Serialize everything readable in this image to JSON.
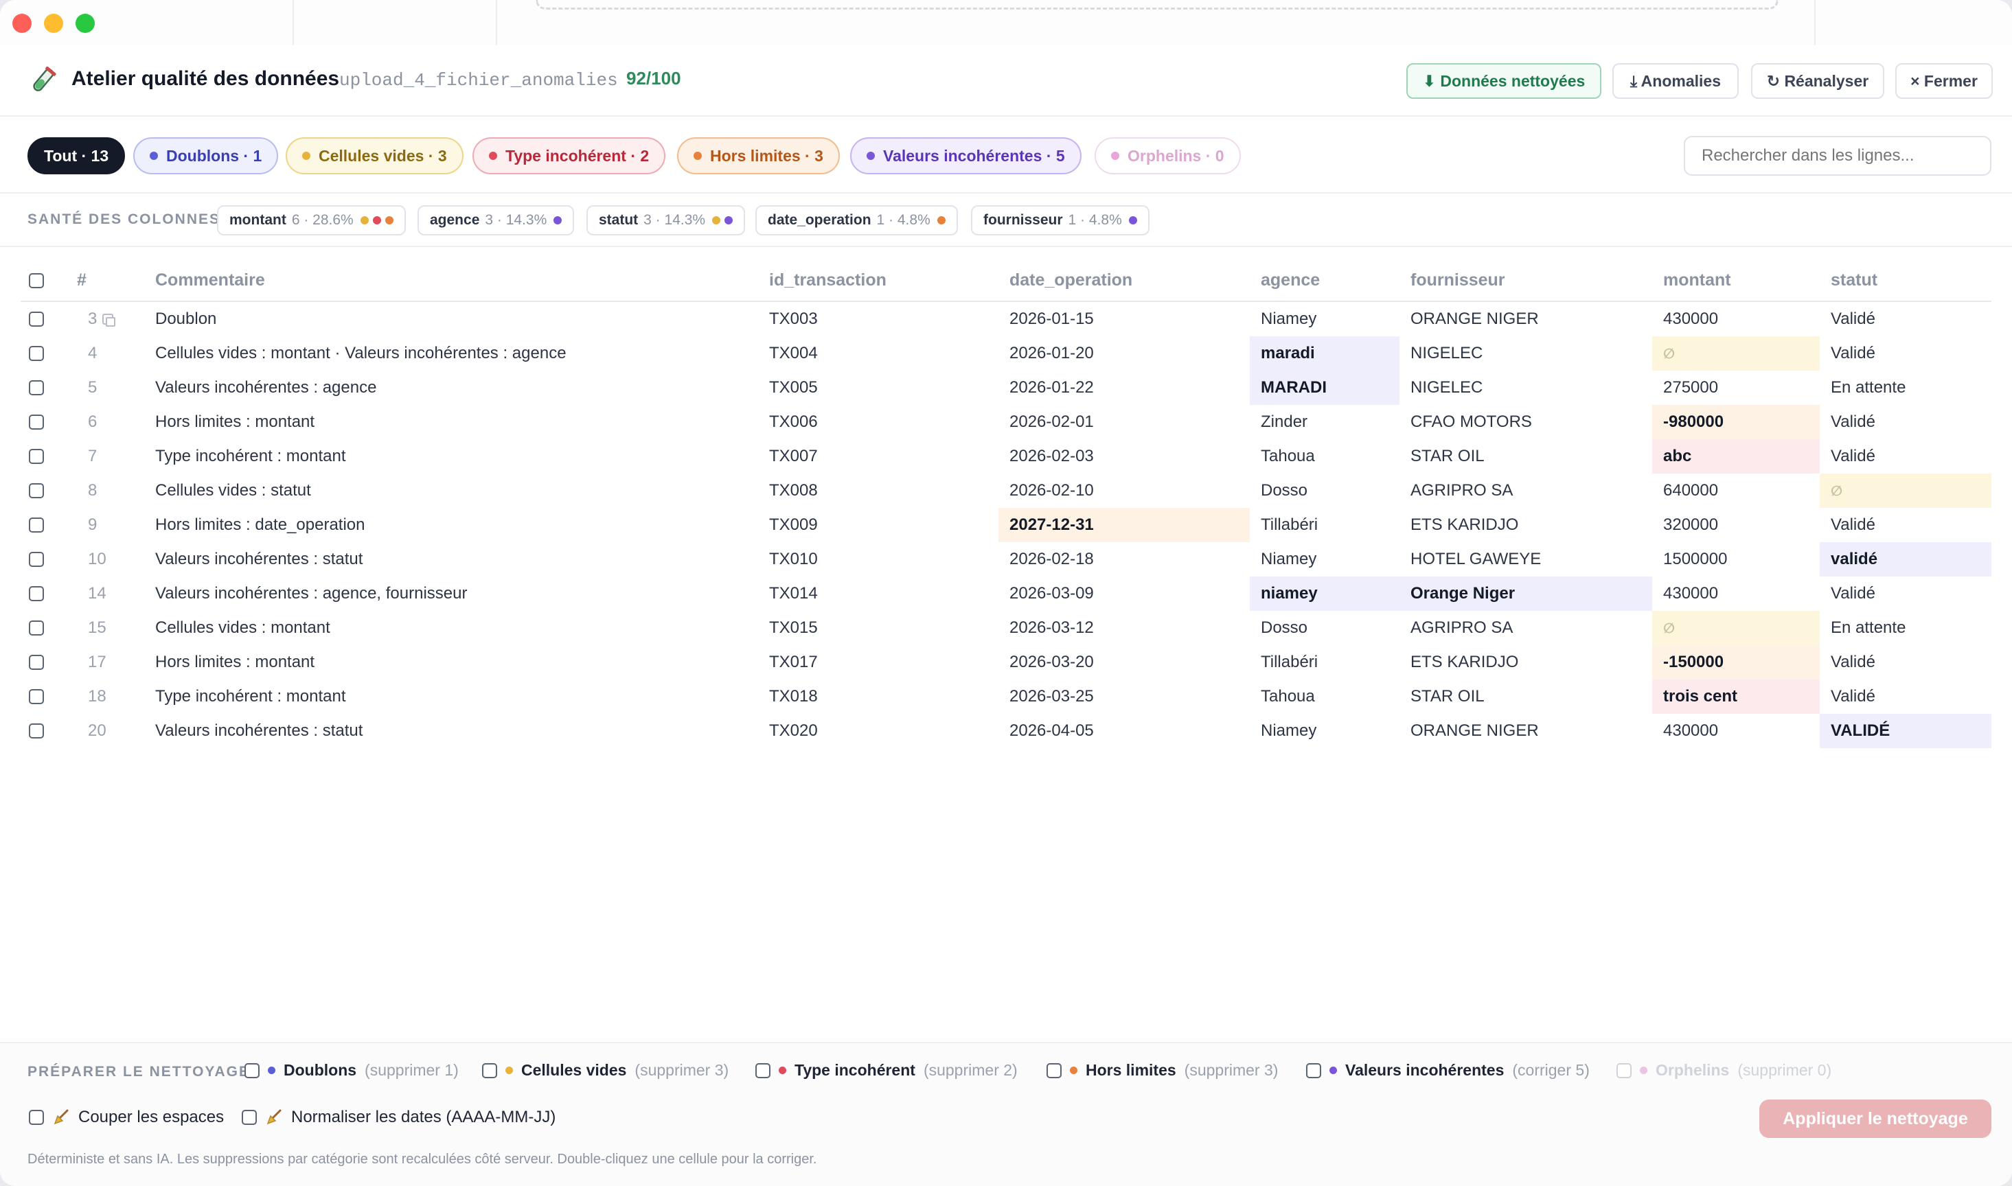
{
  "header": {
    "title": "Atelier qualité des données",
    "file": "upload_4_fichier_anomalies",
    "score": "92/100",
    "buttons": {
      "cleaned": "⬇ Données nettoyées",
      "anomalies": "⤓ Anomalies",
      "reanalyze": "↻ Réanalyser",
      "close": "× Fermer"
    }
  },
  "filters": {
    "all": "Tout · 13",
    "duplicates": "Doublons · 1",
    "empty": "Cellules vides · 3",
    "type": "Type incohérent · 2",
    "bounds": "Hors limites · 3",
    "inconsistent": "Valeurs incohérentes · 5",
    "orphans": "Orphelins · 0",
    "search_placeholder": "Rechercher dans les lignes..."
  },
  "colors": {
    "duplicates": "#5b5fd6",
    "empty": "#e7b23a",
    "type": "#e04a5a",
    "bounds": "#e8813a",
    "inconsistent": "#7a55d8",
    "orphans": "#e9a4d8"
  },
  "health": {
    "label": "SANTÉ DES COLONNES",
    "columns": [
      {
        "name": "montant",
        "stat": "6 · 28.6%"
      },
      {
        "name": "agence",
        "stat": "3 · 14.3%"
      },
      {
        "name": "statut",
        "stat": "3 · 14.3%"
      },
      {
        "name": "date_operation",
        "stat": "1 · 4.8%"
      },
      {
        "name": "fournisseur",
        "stat": "1 · 4.8%"
      }
    ]
  },
  "table": {
    "headers": {
      "num": "#",
      "comment": "Commentaire",
      "id": "id_transaction",
      "date": "date_operation",
      "agence": "agence",
      "fournisseur": "fournisseur",
      "montant": "montant",
      "statut": "statut"
    },
    "empty_symbol": "∅",
    "rows": [
      {
        "num": "3",
        "comment": "Doublon",
        "id": "TX003",
        "date": "2026-01-15",
        "agence": "Niamey",
        "fournisseur": "ORANGE NIGER",
        "montant": "430000",
        "statut": "Validé"
      },
      {
        "num": "4",
        "comment": "Cellules vides : montant · Valeurs incohérentes : agence",
        "id": "TX004",
        "date": "2026-01-20",
        "agence": "maradi",
        "fournisseur": "NIGELEC",
        "montant": "",
        "statut": "Validé"
      },
      {
        "num": "5",
        "comment": "Valeurs incohérentes : agence",
        "id": "TX005",
        "date": "2026-01-22",
        "agence": "MARADI",
        "fournisseur": "NIGELEC",
        "montant": "275000",
        "statut": "En attente"
      },
      {
        "num": "6",
        "comment": "Hors limites : montant",
        "id": "TX006",
        "date": "2026-02-01",
        "agence": "Zinder",
        "fournisseur": "CFAO MOTORS",
        "montant": "-980000",
        "statut": "Validé"
      },
      {
        "num": "7",
        "comment": "Type incohérent : montant",
        "id": "TX007",
        "date": "2026-02-03",
        "agence": "Tahoua",
        "fournisseur": "STAR OIL",
        "montant": "abc",
        "statut": "Validé"
      },
      {
        "num": "8",
        "comment": "Cellules vides : statut",
        "id": "TX008",
        "date": "2026-02-10",
        "agence": "Dosso",
        "fournisseur": "AGRIPRO SA",
        "montant": "640000",
        "statut": ""
      },
      {
        "num": "9",
        "comment": "Hors limites : date_operation",
        "id": "TX009",
        "date": "2027-12-31",
        "agence": "Tillabéri",
        "fournisseur": "ETS KARIDJO",
        "montant": "320000",
        "statut": "Validé"
      },
      {
        "num": "10",
        "comment": "Valeurs incohérentes : statut",
        "id": "TX010",
        "date": "2026-02-18",
        "agence": "Niamey",
        "fournisseur": "HOTEL GAWEYE",
        "montant": "1500000",
        "statut": "validé"
      },
      {
        "num": "14",
        "comment": "Valeurs incohérentes : agence, fournisseur",
        "id": "TX014",
        "date": "2026-03-09",
        "agence": "niamey",
        "fournisseur": "Orange Niger",
        "montant": "430000",
        "statut": "Validé"
      },
      {
        "num": "15",
        "comment": "Cellules vides : montant",
        "id": "TX015",
        "date": "2026-03-12",
        "agence": "Dosso",
        "fournisseur": "AGRIPRO SA",
        "montant": "",
        "statut": "En attente"
      },
      {
        "num": "17",
        "comment": "Hors limites : montant",
        "id": "TX017",
        "date": "2026-03-20",
        "agence": "Tillabéri",
        "fournisseur": "ETS KARIDJO",
        "montant": "-150000",
        "statut": "Validé"
      },
      {
        "num": "18",
        "comment": "Type incohérent : montant",
        "id": "TX018",
        "date": "2026-03-25",
        "agence": "Tahoua",
        "fournisseur": "STAR OIL",
        "montant": "trois cent",
        "statut": "Validé"
      },
      {
        "num": "20",
        "comment": "Valeurs incohérentes : statut",
        "id": "TX020",
        "date": "2026-04-05",
        "agence": "Niamey",
        "fournisseur": "ORANGE NIGER",
        "montant": "430000",
        "statut": "VALIDÉ"
      }
    ]
  },
  "footer": {
    "label": "PRÉPARER LE NETTOYAGE",
    "options": [
      {
        "name": "Doublons",
        "hint": "(supprimer 1)"
      },
      {
        "name": "Cellules vides",
        "hint": "(supprimer 3)"
      },
      {
        "name": "Type incohérent",
        "hint": "(supprimer 2)"
      },
      {
        "name": "Hors limites",
        "hint": "(supprimer 3)"
      },
      {
        "name": "Valeurs incohérentes",
        "hint": "(corriger 5)"
      },
      {
        "name": "Orphelins",
        "hint": "(supprimer 0)"
      }
    ],
    "trim": "Couper les espaces",
    "normalize": "Normaliser les dates (AAAA-MM-JJ)",
    "apply": "Appliquer le nettoyage",
    "note": "Déterministe et sans IA. Les suppressions par catégorie sont recalculées côté serveur. Double-cliquez une cellule pour la corriger."
  }
}
